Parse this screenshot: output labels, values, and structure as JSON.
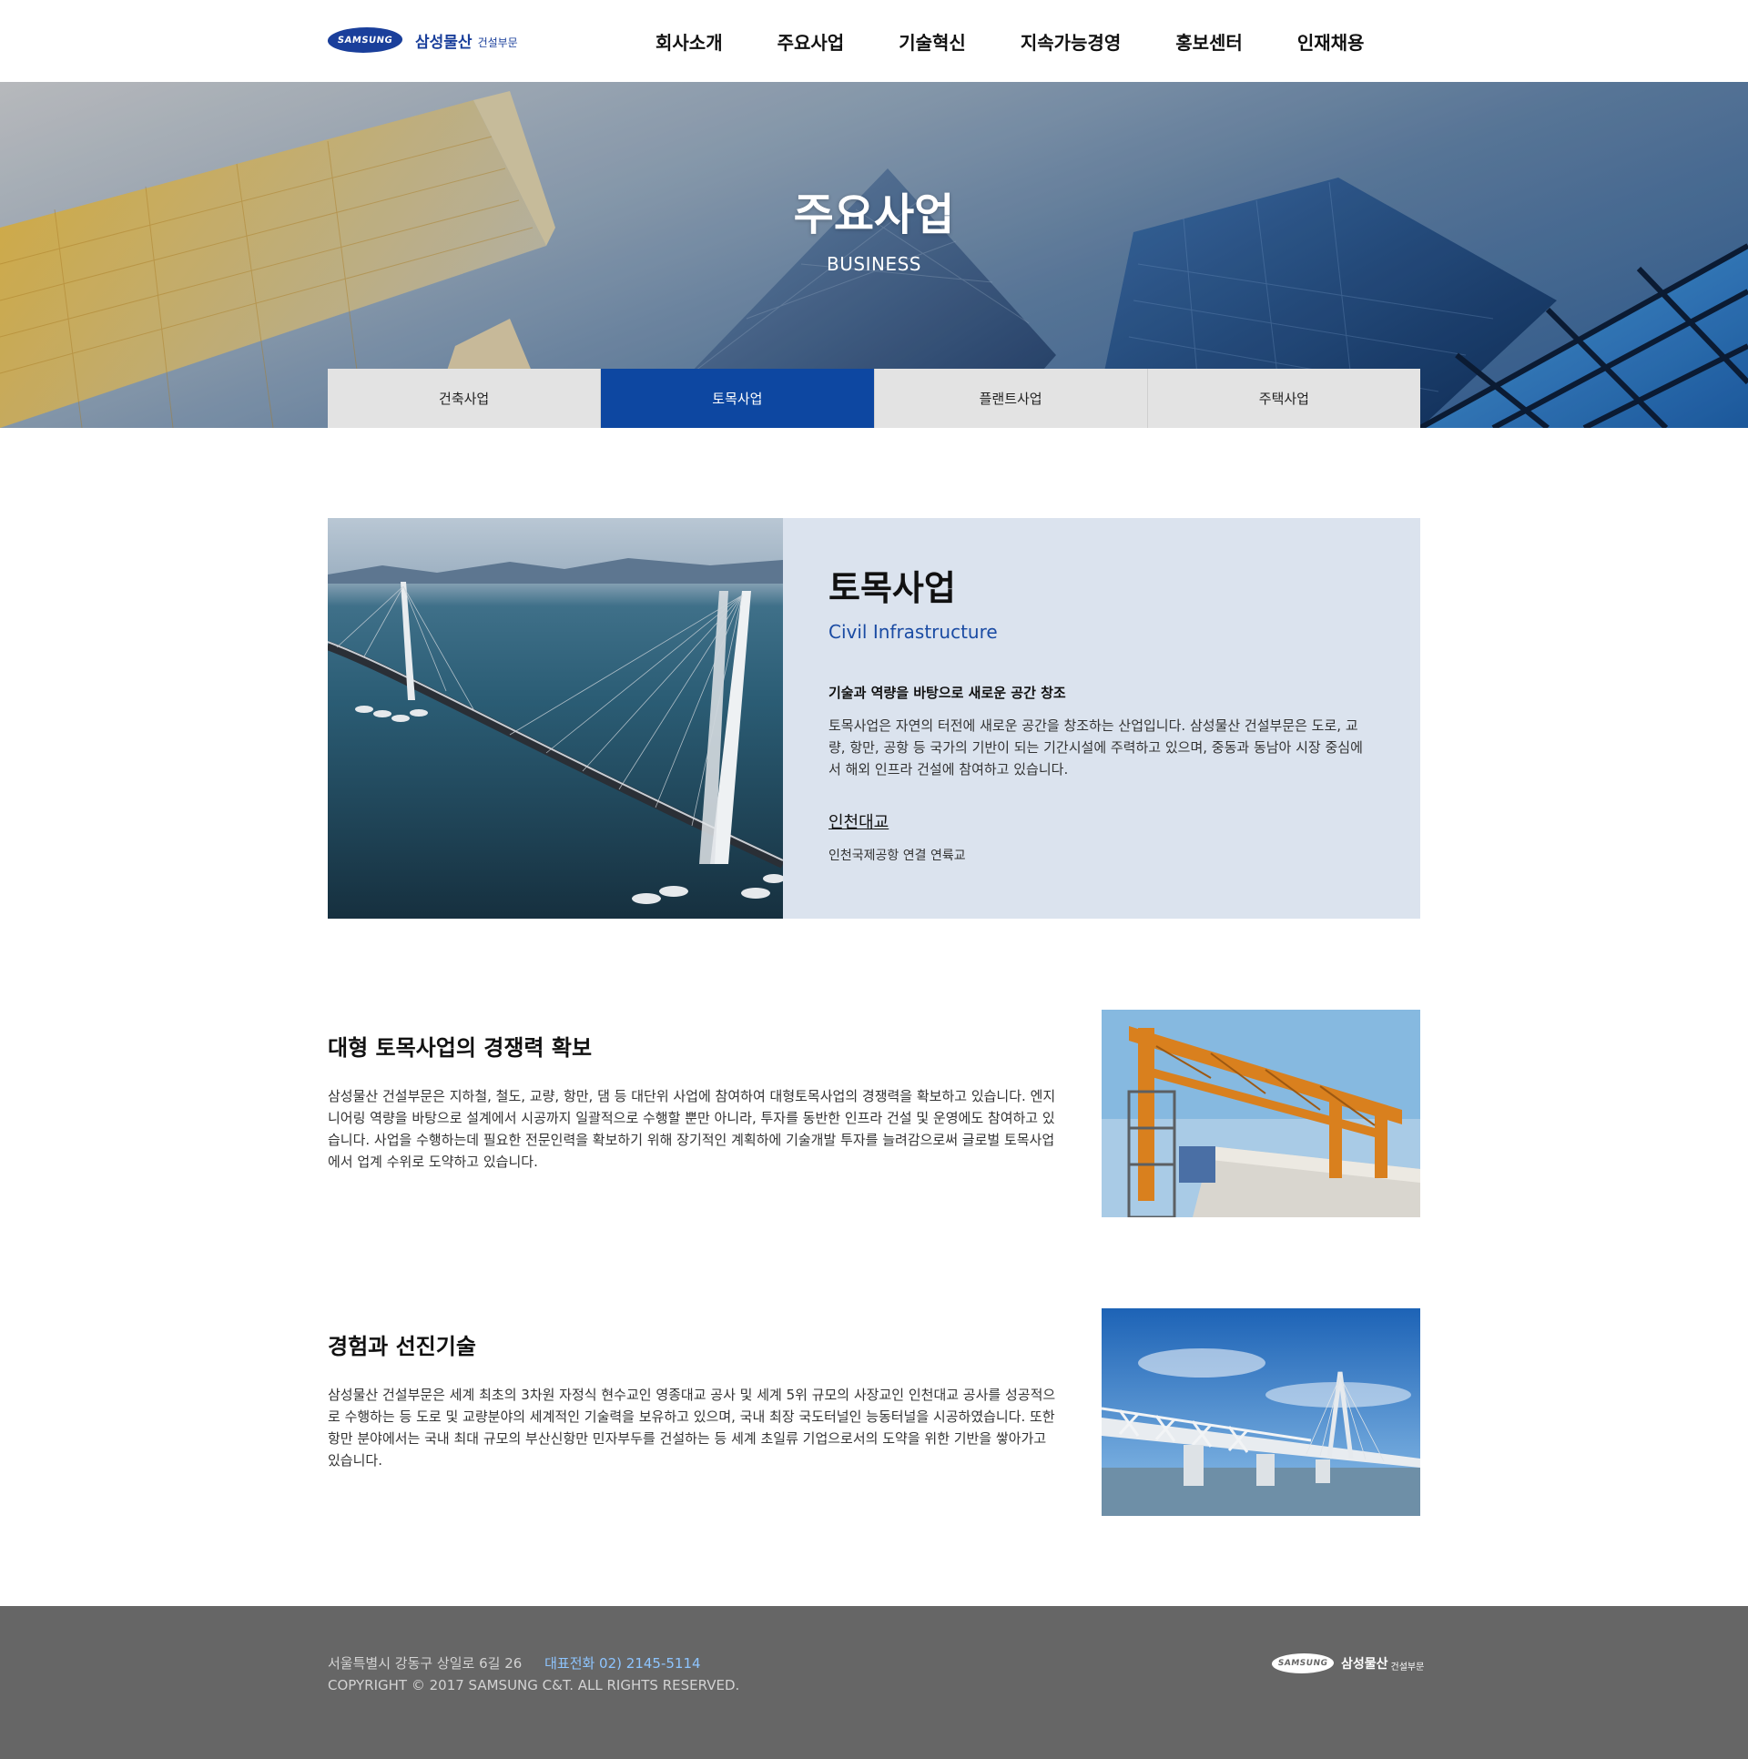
{
  "header": {
    "logo": {
      "mark": "SAMSUNG",
      "name": "삼성물산",
      "sub": "건설부문"
    },
    "nav": [
      "회사소개",
      "주요사업",
      "기술혁신",
      "지속가능경영",
      "홍보센터",
      "인재채용"
    ]
  },
  "hero": {
    "title": "주요사업",
    "subtitle": "BUSINESS",
    "tabs": [
      {
        "label": "건축사업",
        "active": false
      },
      {
        "label": "토목사업",
        "active": true
      },
      {
        "label": "플랜트사업",
        "active": false
      },
      {
        "label": "주택사업",
        "active": false
      }
    ]
  },
  "intro": {
    "title": "토목사업",
    "subtitle_en": "Civil Infrastructure",
    "lead": "기술과 역량을 바탕으로 새로운 공간 창조",
    "description": "토목사업은 자연의 터전에 새로운 공간을 창조하는 산업입니다. 삼성물산 건설부문은 도로, 교량, 항만, 공항 등 국가의 기반이 되는 기간시설에 주력하고 있으며, 중동과 동남아 시장 중심에서 해외 인프라 건설에 참여하고 있습니다.",
    "link": "인천대교",
    "link_desc": "인천국제공항 연결 연륙교"
  },
  "features": [
    {
      "title": "대형 토목사업의 경쟁력 확보",
      "description": "삼성물산 건설부문은 지하철, 철도, 교량, 항만, 댐 등 대단위 사업에 참여하여 대형토목사업의 경쟁력을 확보하고 있습니다. 엔지니어링 역량을 바탕으로 설계에서 시공까지 일괄적으로 수행할 뿐만 아니라, 투자를 동반한 인프라 건설 및 운영에도 참여하고 있습니다. 사업을 수행하는데 필요한 전문인력을 확보하기 위해 장기적인 계획하에 기술개발 투자를 늘려감으로써 글로벌 토목사업에서 업계 수위로 도약하고 있습니다."
    },
    {
      "title": "경험과 선진기술",
      "description": "삼성물산 건설부문은 세계 최초의 3차원 자정식 현수교인 영종대교 공사 및 세계 5위 규모의 사장교인 인천대교 공사를 성공적으로 수행하는 등 도로 및 교량분야의 세계적인 기술력을 보유하고 있으며, 국내 최장 국도터널인 능동터널을 시공하였습니다. 또한 항만 분야에서는 국내 최대 규모의 부산신항만 민자부두를 건설하는 등 세계 초일류 기업으로서의 도약을 위한 기반을 쌓아가고 있습니다."
    }
  ],
  "footer": {
    "address": "서울특별시 강동구 상일로 6길 26",
    "tel": "대표전화 02) 2145-5114",
    "copyright": "COPYRIGHT © 2017 SAMSUNG C&T. ALL RIGHTS RESERVED.",
    "logo": {
      "mark": "SAMSUNG",
      "name": "삼성물산",
      "sub": "건설부문"
    }
  },
  "colors": {
    "brand": "#1a3f9b",
    "active_tab": "#0d47a1",
    "intro_panel": "#dbe3ee",
    "footer_bg": "#666666",
    "footer_tel": "#8ec5ff"
  }
}
